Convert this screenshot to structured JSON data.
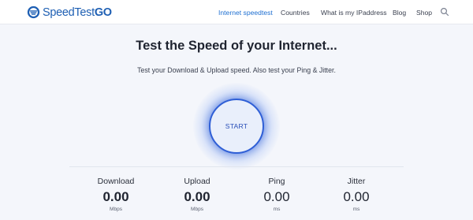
{
  "header": {
    "logo": {
      "text_light": "SpeedTest",
      "text_bold": "GO",
      "icon": "speedometer-shield-icon"
    },
    "nav": [
      {
        "label": "Internet speedtest",
        "active": true
      },
      {
        "label": "Countries",
        "active": false
      },
      {
        "label": "What is my IPaddress",
        "active": false
      },
      {
        "label": "Blog",
        "active": false
      },
      {
        "label": "Shop",
        "active": false
      }
    ],
    "search_icon": "search-icon"
  },
  "hero": {
    "title": "Test the Speed of your Internet...",
    "subtitle": "Test your Download & Upload speed. Also test your Ping & Jitter.",
    "start_label": "START"
  },
  "metrics": [
    {
      "label": "Download",
      "value": "0.00",
      "unit": "Mbps"
    },
    {
      "label": "Upload",
      "value": "0.00",
      "unit": "Mbps"
    },
    {
      "label": "Ping",
      "value": "0.00",
      "unit": "ms"
    },
    {
      "label": "Jitter",
      "value": "0.00",
      "unit": "ms"
    }
  ],
  "colors": {
    "brand": "#1e5fb3",
    "accent": "#2f5fd6",
    "active_nav": "#1e6fd1",
    "background": "#f4f6fb"
  }
}
